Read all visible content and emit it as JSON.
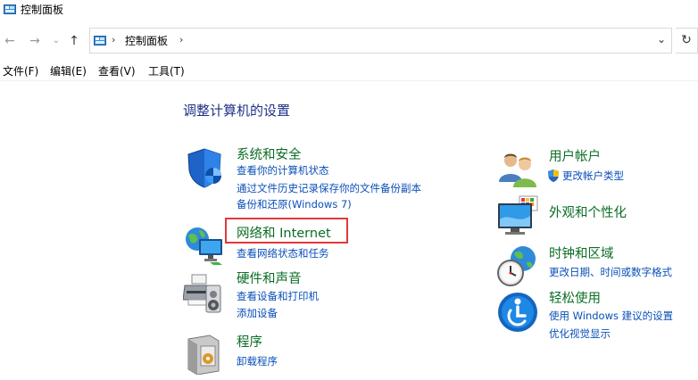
{
  "window": {
    "title": "控制面板"
  },
  "nav": {
    "back_glyph": "←",
    "forward_glyph": "→",
    "recent_glyph": "⌄",
    "up_glyph": "↑",
    "address_path": "控制面板",
    "path_separator": "›",
    "dropdown_glyph": "⌄",
    "refresh_glyph": "↻"
  },
  "menu": {
    "items": [
      "文件(F)",
      "编辑(E)",
      "查看(V)",
      "工具(T)"
    ]
  },
  "main": {
    "heading": "调整计算机的设置",
    "left": [
      {
        "title": "系统和安全",
        "icon": "shield-icon",
        "links": [
          "查看你的计算机状态",
          "通过文件历史记录保存你的文件备份副本",
          "备份和还原(Windows 7)"
        ]
      },
      {
        "title": "网络和 Internet",
        "icon": "network-globe-icon",
        "links": [
          "查看网络状态和任务"
        ]
      },
      {
        "title": "硬件和声音",
        "icon": "printer-speaker-icon",
        "links": [
          "查看设备和打印机",
          "添加设备"
        ]
      },
      {
        "title": "程序",
        "icon": "program-box-icon",
        "links": [
          "卸载程序"
        ]
      }
    ],
    "right": [
      {
        "title": "用户帐户",
        "icon": "users-icon",
        "links": [
          "更改帐户类型"
        ]
      },
      {
        "title": "外观和个性化",
        "icon": "monitor-palette-icon",
        "links": []
      },
      {
        "title": "时钟和区域",
        "icon": "clock-globe-icon",
        "links": [
          "更改日期、时间或数字格式"
        ]
      },
      {
        "title": "轻松使用",
        "icon": "accessibility-icon",
        "links": [
          "使用 Windows 建议的设置",
          "优化视觉显示"
        ]
      }
    ]
  },
  "colors": {
    "category_title": "#0b6d26",
    "link": "#0a4fb8",
    "heading": "#1e3287",
    "highlight": "#e03a3a"
  }
}
